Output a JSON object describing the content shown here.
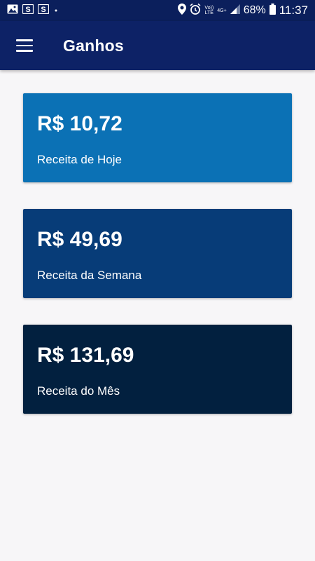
{
  "status_bar": {
    "icons_left": [
      "image-icon",
      "s-app-icon",
      "s-app-icon",
      "dot-icon"
    ],
    "volte_label": "Vo))\nLTE",
    "network_label": "4G+",
    "battery": "68%",
    "time": "11:37"
  },
  "appbar": {
    "title": "Ganhos"
  },
  "cards": {
    "today": {
      "amount": "R$ 10,72",
      "label": "Receita de Hoje",
      "color": "#0b71b5"
    },
    "week": {
      "amount": "R$ 49,69",
      "label": "Receita da Semana",
      "color": "#073c78"
    },
    "month": {
      "amount": "R$ 131,69",
      "label": "Receita do Mês",
      "color": "#02203f"
    }
  },
  "colors": {
    "appbar": "#0d2266",
    "status_bar": "#0b1f5c",
    "background": "#f7f6f8"
  }
}
